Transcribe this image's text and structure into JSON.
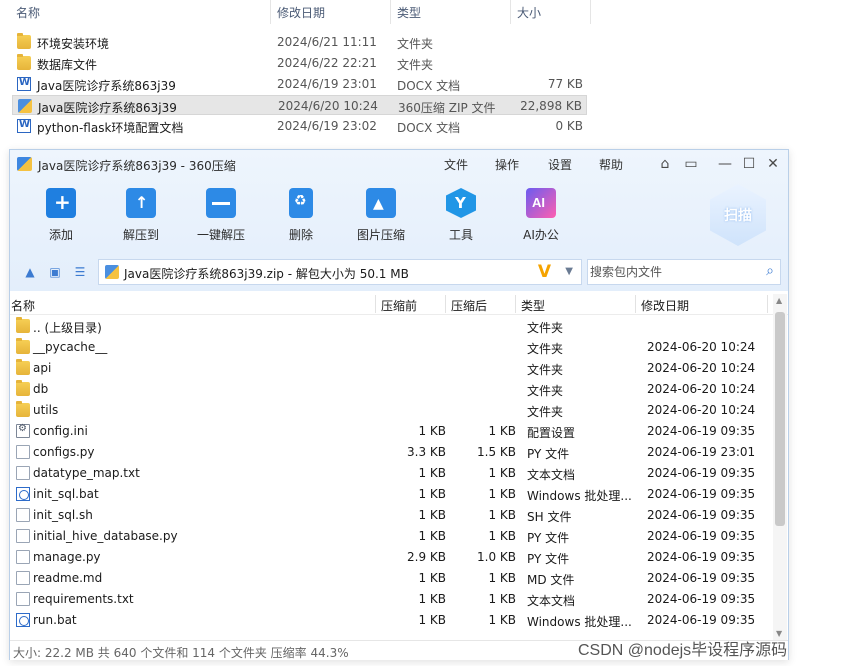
{
  "explorer": {
    "columns": {
      "name": "名称",
      "date": "修改日期",
      "type": "类型",
      "size": "大小"
    },
    "rows": [
      {
        "icon": "folder-icon",
        "name": "环境安装环境",
        "date": "2024/6/21 11:11",
        "type": "文件夹",
        "size": ""
      },
      {
        "icon": "folder-icon",
        "name": "数据库文件",
        "date": "2024/6/22 22:21",
        "type": "文件夹",
        "size": ""
      },
      {
        "icon": "word-doc-icon",
        "name": "Java医院诊疗系统863j39",
        "date": "2024/6/19 23:01",
        "type": "DOCX 文档",
        "size": "77 KB"
      },
      {
        "icon": "zip-icon",
        "name": "Java医院诊疗系统863j39",
        "date": "2024/6/20 10:24",
        "type": "360压缩 ZIP 文件",
        "size": "22,898 KB",
        "selected": true
      },
      {
        "icon": "word-doc-icon",
        "name": "python-flask环境配置文档",
        "date": "2024/6/19 23:02",
        "type": "DOCX 文档",
        "size": "0 KB"
      }
    ]
  },
  "window": {
    "title": "Java医院诊疗系统863j39 - 360压缩",
    "menu": [
      "文件",
      "操作",
      "设置",
      "帮助"
    ],
    "toolbar": [
      {
        "icon": "add-icon",
        "label": "添加"
      },
      {
        "icon": "extract-to-icon",
        "label": "解压到"
      },
      {
        "icon": "one-click-extract-icon",
        "label": "一键解压"
      },
      {
        "icon": "delete-icon",
        "label": "删除"
      },
      {
        "icon": "image-compress-icon",
        "label": "图片压缩"
      },
      {
        "icon": "tools-icon",
        "label": "工具"
      },
      {
        "icon": "ai-office-icon",
        "label": "AI办公"
      }
    ],
    "scan_label": "扫描",
    "path": "Java医院诊疗系统863j39.zip - 解包大小为 50.1 MB",
    "search_placeholder": "搜索包内文件",
    "list_columns": {
      "name": "名称",
      "compressed_before": "压缩前",
      "compressed_after": "压缩后",
      "type": "类型",
      "modified": "修改日期"
    },
    "files": [
      {
        "icon": "folder-icon",
        "name": ".. (上级目录)",
        "before": "",
        "after": "",
        "type": "文件夹",
        "date": ""
      },
      {
        "icon": "folder-icon",
        "name": "__pycache__",
        "before": "",
        "after": "",
        "type": "文件夹",
        "date": "2024-06-20 10:24"
      },
      {
        "icon": "folder-icon",
        "name": "api",
        "before": "",
        "after": "",
        "type": "文件夹",
        "date": "2024-06-20 10:24"
      },
      {
        "icon": "folder-icon",
        "name": "db",
        "before": "",
        "after": "",
        "type": "文件夹",
        "date": "2024-06-20 10:24"
      },
      {
        "icon": "folder-icon",
        "name": "utils",
        "before": "",
        "after": "",
        "type": "文件夹",
        "date": "2024-06-20 10:24"
      },
      {
        "icon": "settings-file-icon",
        "name": "config.ini",
        "before": "1 KB",
        "after": "1 KB",
        "type": "配置设置",
        "date": "2024-06-19 09:35"
      },
      {
        "icon": "file-icon",
        "name": "configs.py",
        "before": "3.3 KB",
        "after": "1.5 KB",
        "type": "PY 文件",
        "date": "2024-06-19 23:01"
      },
      {
        "icon": "file-icon",
        "name": "datatype_map.txt",
        "before": "1 KB",
        "after": "1 KB",
        "type": "文本文档",
        "date": "2024-06-19 09:35"
      },
      {
        "icon": "batch-file-icon",
        "name": "init_sql.bat",
        "before": "1 KB",
        "after": "1 KB",
        "type": "Windows 批处理...",
        "date": "2024-06-19 09:35"
      },
      {
        "icon": "file-icon",
        "name": "init_sql.sh",
        "before": "1 KB",
        "after": "1 KB",
        "type": "SH 文件",
        "date": "2024-06-19 09:35"
      },
      {
        "icon": "file-icon",
        "name": "initial_hive_database.py",
        "before": "1 KB",
        "after": "1 KB",
        "type": "PY 文件",
        "date": "2024-06-19 09:35"
      },
      {
        "icon": "file-icon",
        "name": "manage.py",
        "before": "2.9 KB",
        "after": "1.0 KB",
        "type": "PY 文件",
        "date": "2024-06-19 09:35"
      },
      {
        "icon": "file-icon",
        "name": "readme.md",
        "before": "1 KB",
        "after": "1 KB",
        "type": "MD 文件",
        "date": "2024-06-19 09:35"
      },
      {
        "icon": "file-icon",
        "name": "requirements.txt",
        "before": "1 KB",
        "after": "1 KB",
        "type": "文本文档",
        "date": "2024-06-19 09:35"
      },
      {
        "icon": "batch-file-icon",
        "name": "run.bat",
        "before": "1 KB",
        "after": "1 KB",
        "type": "Windows 批处理...",
        "date": "2024-06-19 09:35"
      }
    ],
    "status": "大小: 22.2 MB 共 640 个文件和 114 个文件夹 压缩率 44.3%"
  },
  "watermark": "CSDN @nodejs毕设程序源码"
}
